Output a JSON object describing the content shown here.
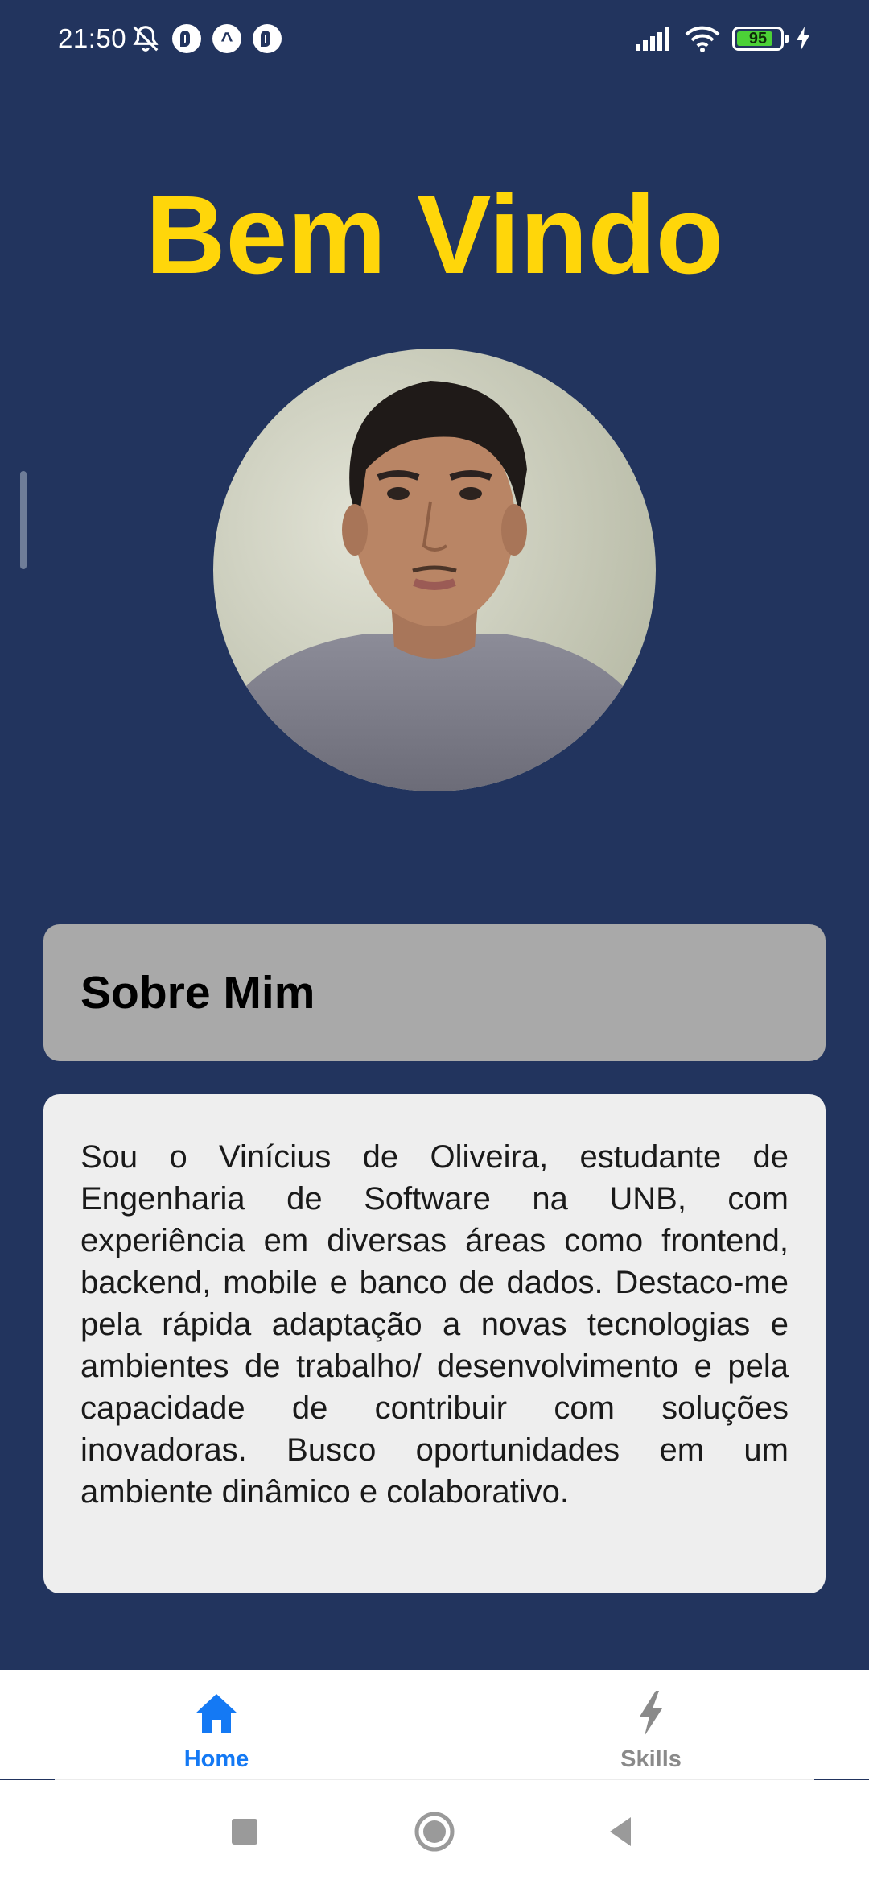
{
  "status_bar": {
    "time": "21:50",
    "battery_level": "95",
    "icons": [
      "bell-off-icon",
      "notification-app-icon",
      "caret-up-icon",
      "notification-app-icon",
      "signal-icon",
      "wifi-icon",
      "battery-icon",
      "charging-bolt-icon"
    ]
  },
  "page": {
    "title": "Bem Vindo",
    "avatar_alt": "profile-photo"
  },
  "about": {
    "header": "Sobre Mim",
    "body": "Sou o Vinícius de Oliveira, estudante de Engenharia de Software na UNB, com experiência em diversas áreas como frontend, backend, mobile e banco de dados. Destaco-me pela rápida adaptação a novas tecnologias e ambientes de trabalho/ desenvolvimento e pela capacidade de contribuir com soluções inovadoras. Busco oportunidades em um ambiente dinâmico e colaborativo."
  },
  "tabs": [
    {
      "label": "Home",
      "icon": "home-icon",
      "active": true
    },
    {
      "label": "Skills",
      "icon": "bolt-icon",
      "active": false
    }
  ],
  "colors": {
    "background": "#22345e",
    "title": "#ffd60a",
    "tab_active": "#1479f4",
    "tab_inactive": "#8a8a8a",
    "about_header_bg": "#a9a9a9",
    "about_body_bg": "#eeeeee"
  },
  "system_nav": {
    "buttons": [
      "recent-apps-icon",
      "home-circle-icon",
      "back-triangle-icon"
    ]
  }
}
